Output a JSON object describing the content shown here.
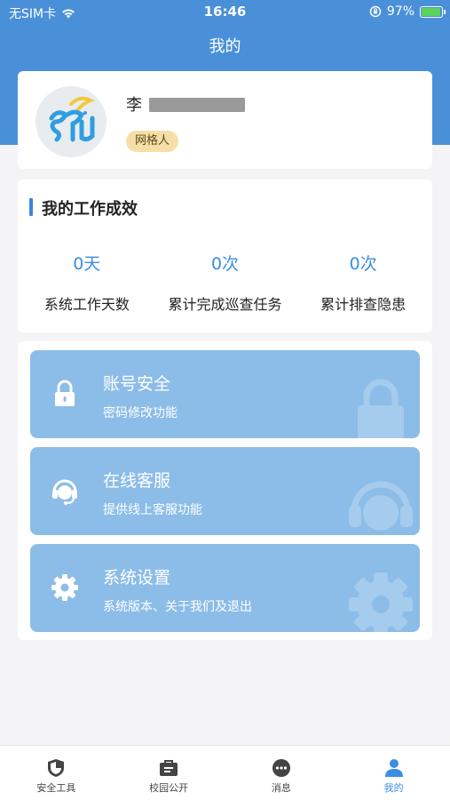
{
  "status_bar": {
    "carrier": "无SIM卡",
    "time": "16:46",
    "battery": "97%",
    "battery_level": 0.97
  },
  "header": {
    "title": "我的"
  },
  "profile": {
    "name": "李",
    "role": "网格人"
  },
  "work": {
    "title": "我的工作成效",
    "stats": [
      {
        "value": "0天",
        "label": "系统工作天数"
      },
      {
        "value": "0次",
        "label": "累计完成巡查任务"
      },
      {
        "value": "0次",
        "label": "累计排查隐患"
      }
    ]
  },
  "menu": [
    {
      "title": "账号安全",
      "subtitle": "密码修改功能",
      "icon": "lock-icon"
    },
    {
      "title": "在线客服",
      "subtitle": "提供线上客服功能",
      "icon": "headset-icon"
    },
    {
      "title": "系统设置",
      "subtitle": "系统版本、关于我们及退出",
      "icon": "gear-icon"
    }
  ],
  "tabs": [
    {
      "label": "安全工具",
      "icon": "shield-icon",
      "active": false
    },
    {
      "label": "校园公开",
      "icon": "briefcase-icon",
      "active": false
    },
    {
      "label": "消息",
      "icon": "chat-icon",
      "active": false
    },
    {
      "label": "我的",
      "icon": "user-icon",
      "active": true
    }
  ],
  "colors": {
    "primary": "#4a90d9",
    "menu_card": "#8cbde8",
    "stat_value": "#3a8ee5",
    "badge_bg": "#f5dfa6"
  }
}
